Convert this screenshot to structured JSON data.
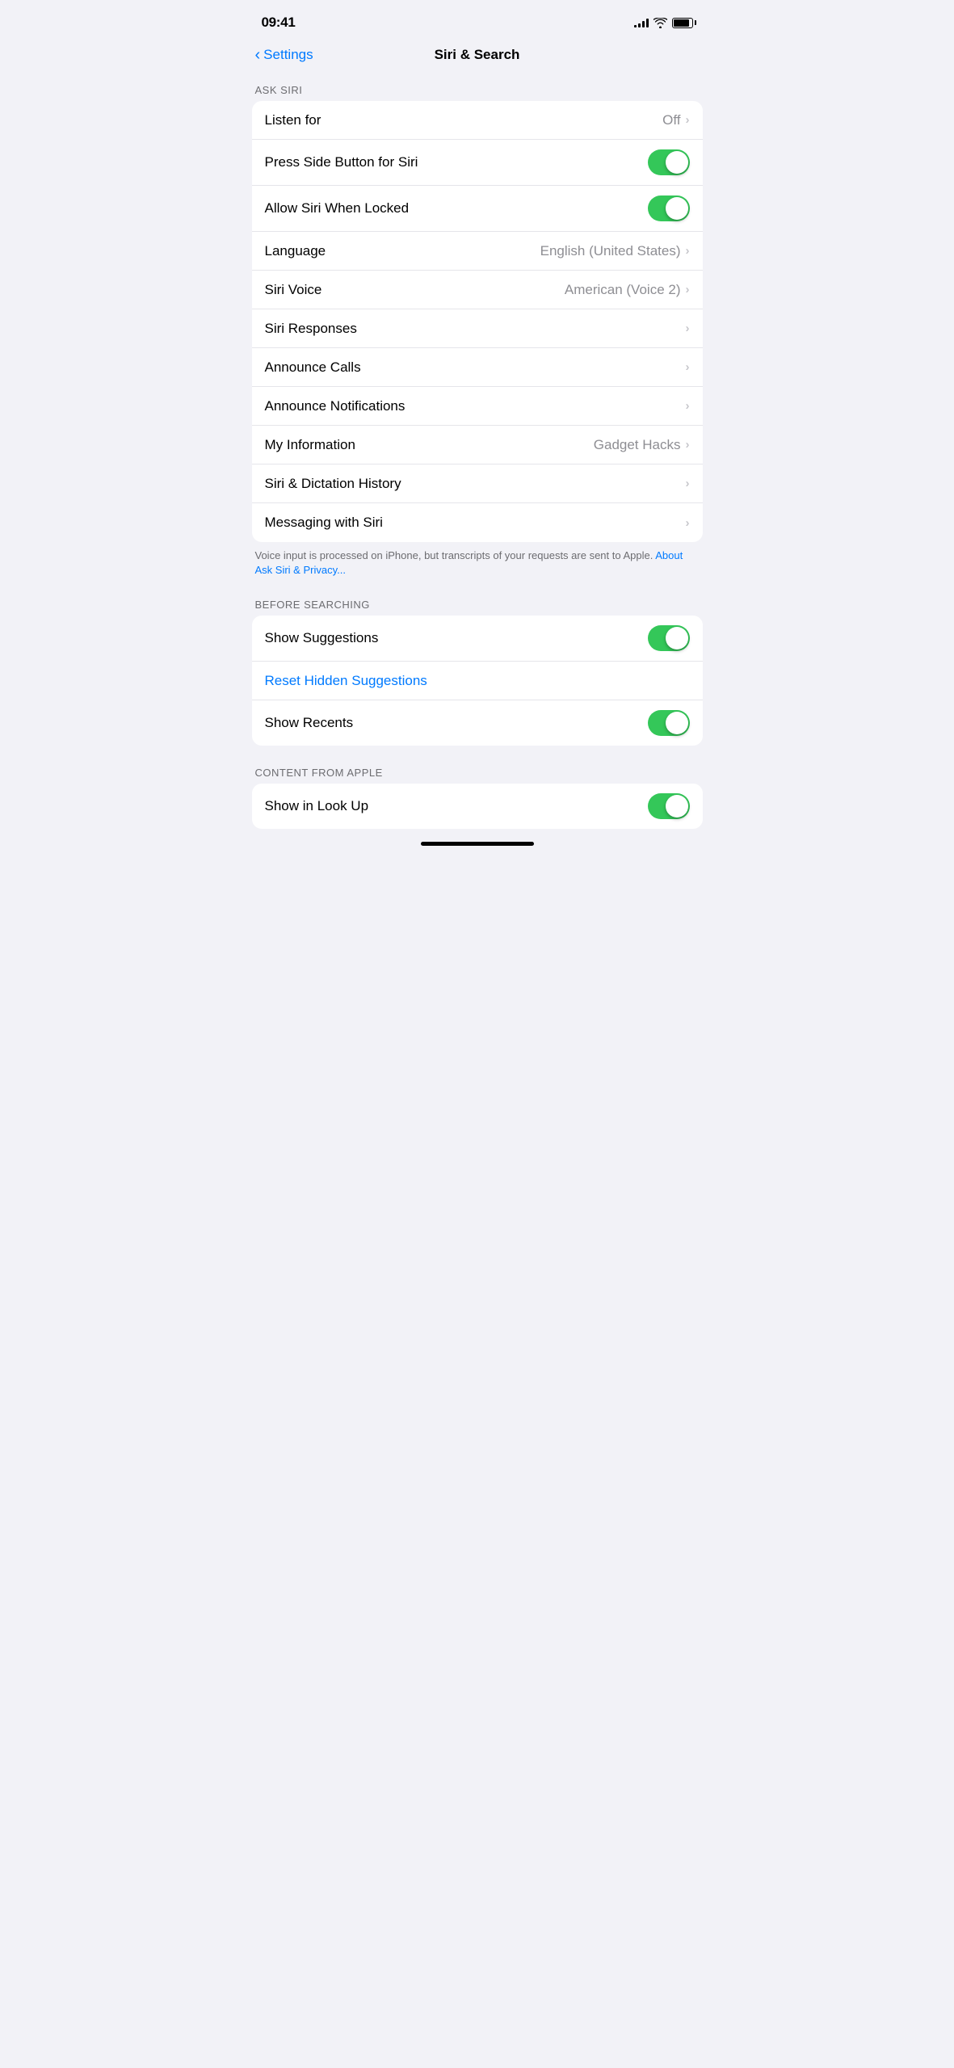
{
  "status_bar": {
    "time": "09:41"
  },
  "nav": {
    "back_label": "Settings",
    "title": "Siri & Search"
  },
  "ask_siri_section": {
    "header": "ASK SIRI",
    "rows": [
      {
        "id": "listen-for",
        "label": "Listen for",
        "value": "Off",
        "has_chevron": true,
        "toggle": null
      },
      {
        "id": "press-side-button",
        "label": "Press Side Button for Siri",
        "value": null,
        "has_chevron": false,
        "toggle": "on"
      },
      {
        "id": "allow-locked",
        "label": "Allow Siri When Locked",
        "value": null,
        "has_chevron": false,
        "toggle": "on"
      },
      {
        "id": "language",
        "label": "Language",
        "value": "English (United States)",
        "has_chevron": true,
        "toggle": null
      },
      {
        "id": "siri-voice",
        "label": "Siri Voice",
        "value": "American (Voice 2)",
        "has_chevron": true,
        "toggle": null
      },
      {
        "id": "siri-responses",
        "label": "Siri Responses",
        "value": null,
        "has_chevron": true,
        "toggle": null
      },
      {
        "id": "announce-calls",
        "label": "Announce Calls",
        "value": null,
        "has_chevron": true,
        "toggle": null
      },
      {
        "id": "announce-notifications",
        "label": "Announce Notifications",
        "value": null,
        "has_chevron": true,
        "toggle": null
      },
      {
        "id": "my-information",
        "label": "My Information",
        "value": "Gadget Hacks",
        "has_chevron": true,
        "toggle": null
      },
      {
        "id": "siri-dictation-history",
        "label": "Siri & Dictation History",
        "value": null,
        "has_chevron": true,
        "toggle": null
      },
      {
        "id": "messaging-siri",
        "label": "Messaging with Siri",
        "value": null,
        "has_chevron": true,
        "toggle": null
      }
    ],
    "footer_text": "Voice input is processed on iPhone, but transcripts of your requests are sent to Apple.",
    "footer_link": "About Ask Siri & Privacy..."
  },
  "before_searching_section": {
    "header": "BEFORE SEARCHING",
    "rows": [
      {
        "id": "show-suggestions",
        "label": "Show Suggestions",
        "value": null,
        "has_chevron": false,
        "toggle": "on"
      }
    ],
    "reset_label": "Reset Hidden Suggestions",
    "rows2": [
      {
        "id": "show-recents",
        "label": "Show Recents",
        "value": null,
        "has_chevron": false,
        "toggle": "on"
      }
    ]
  },
  "content_from_apple_section": {
    "header": "CONTENT FROM APPLE",
    "rows": [
      {
        "id": "show-look-up",
        "label": "Show in Look Up",
        "value": null,
        "has_chevron": false,
        "toggle": "on"
      }
    ]
  }
}
